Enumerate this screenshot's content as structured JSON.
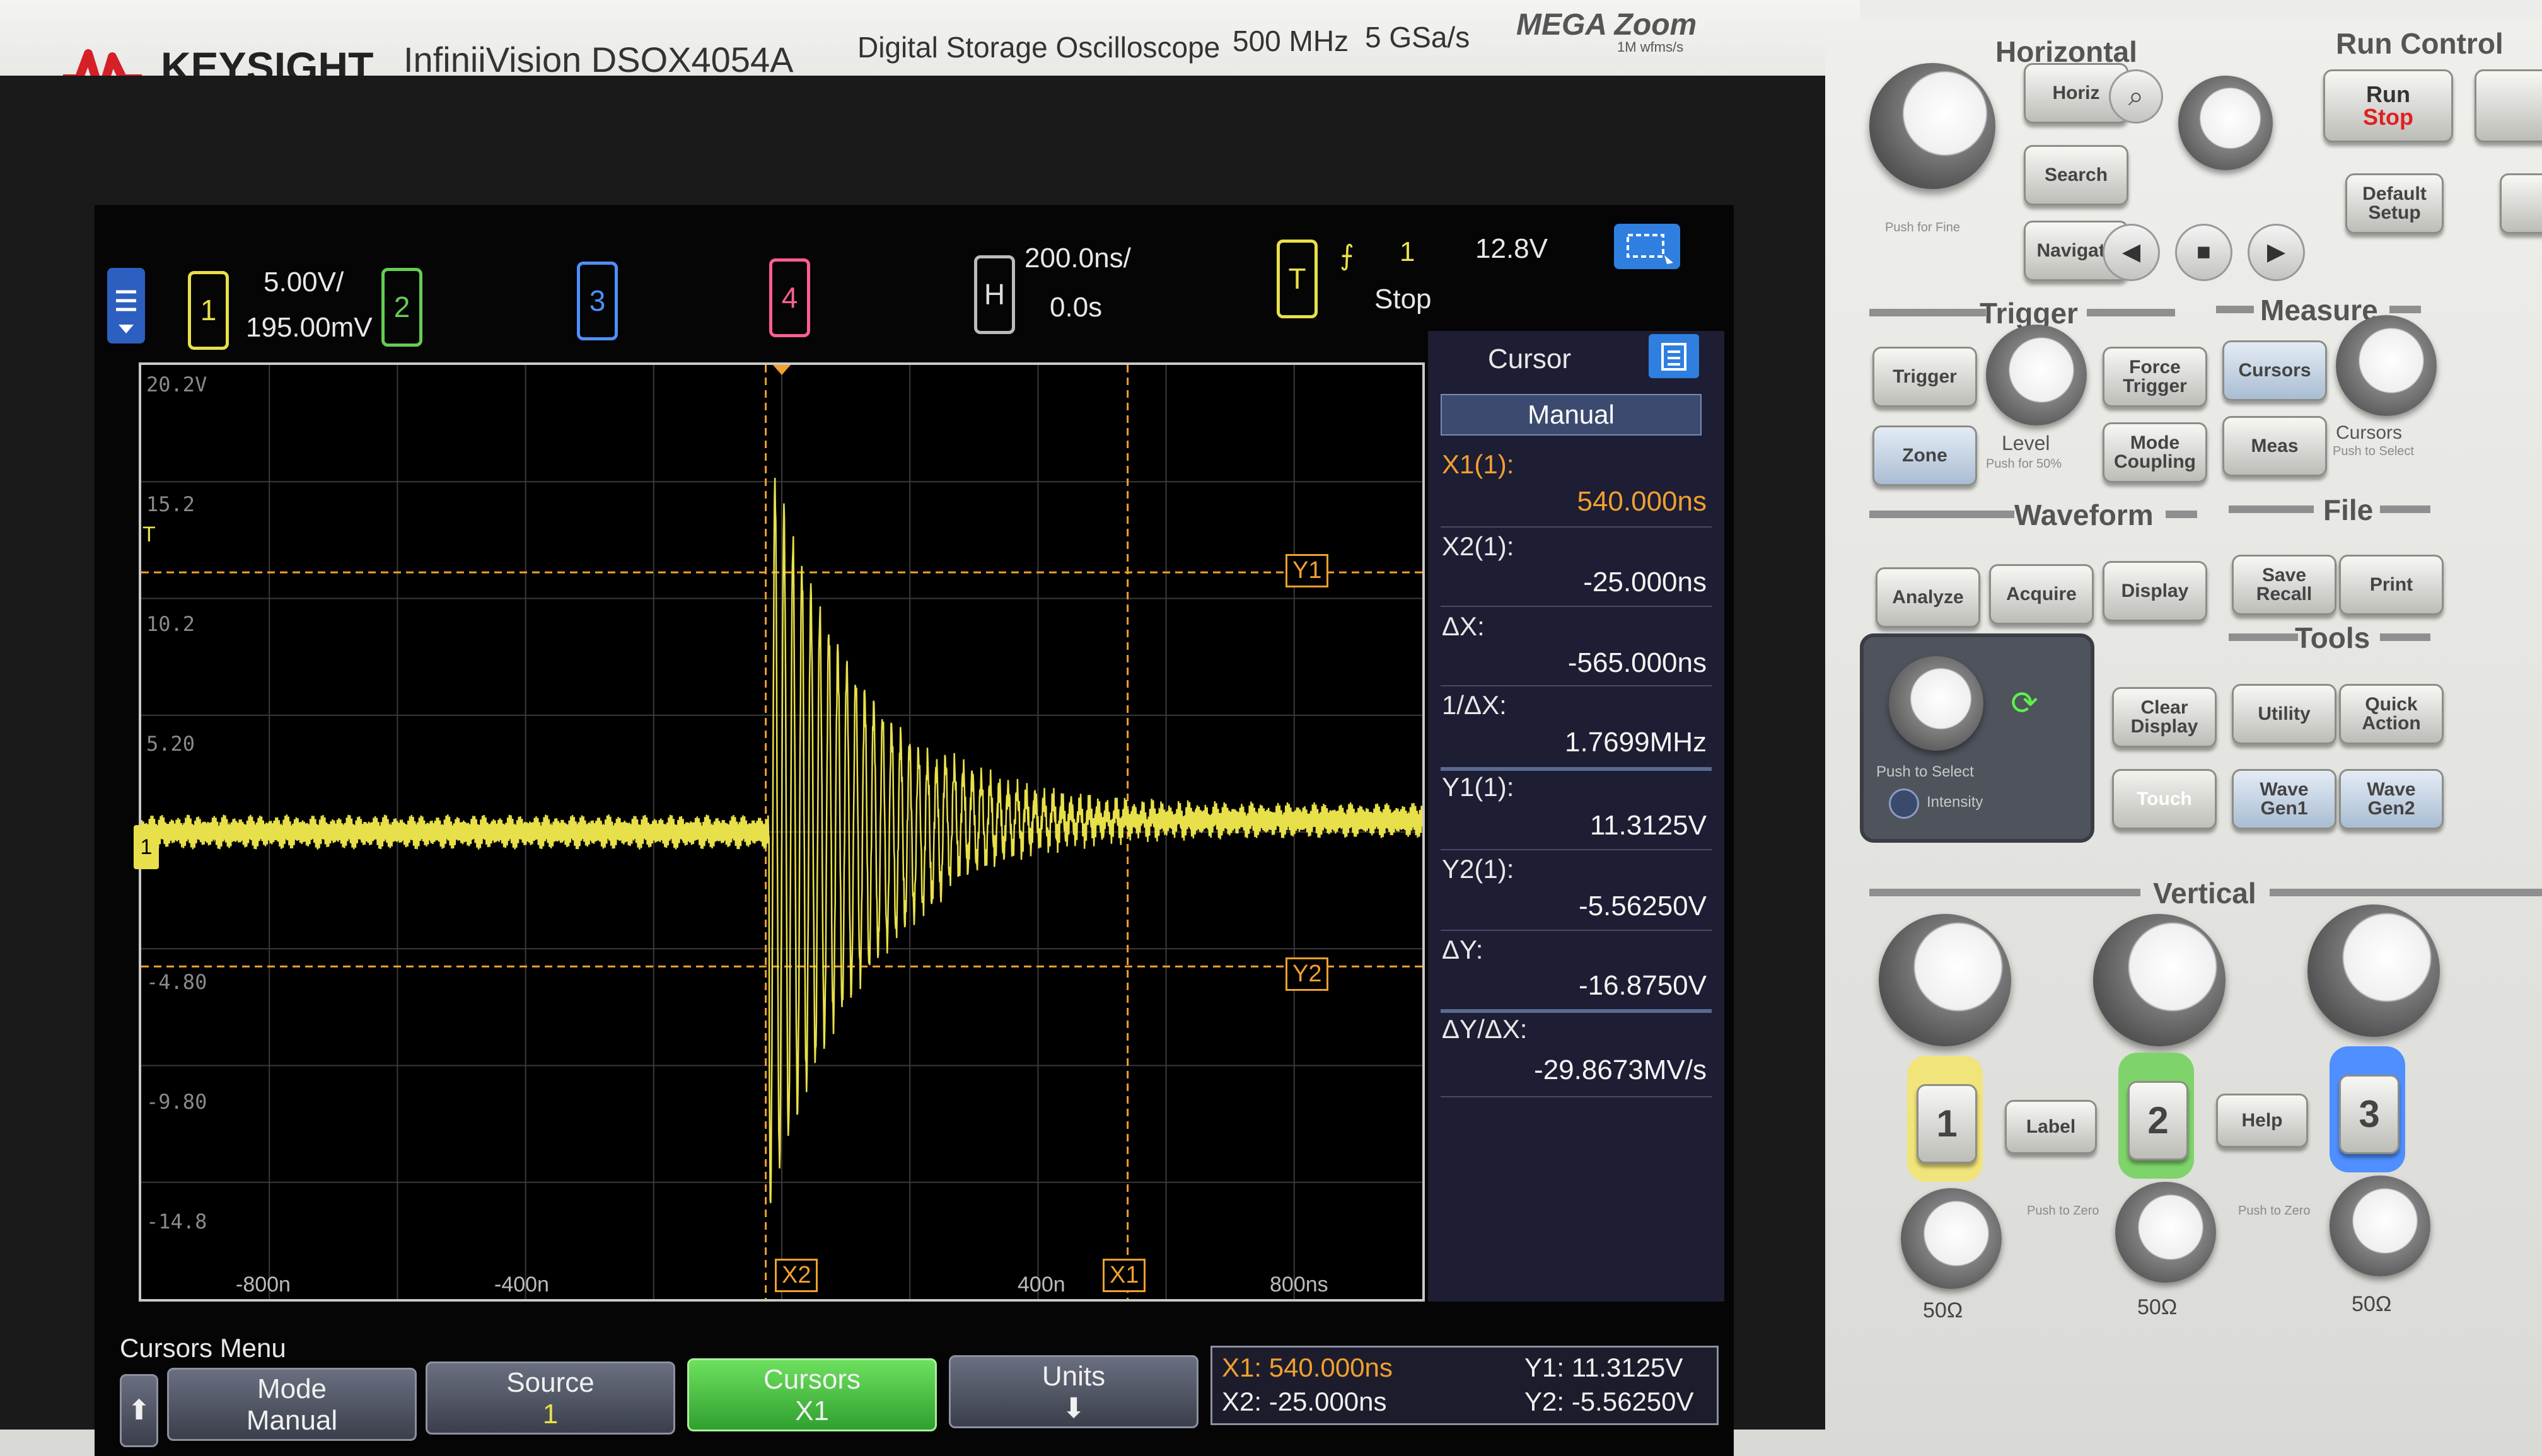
{
  "brand": {
    "logo": "KEYSIGHT",
    "model": "InfiniiVision DSOX4054A",
    "type": "Digital Storage Oscilloscope",
    "bandwidth": "500 MHz",
    "sample_rate": "5 GSa/s",
    "megazoom": "MEGA Zoom",
    "megazoom_sub": "1M wfms/s"
  },
  "header": {
    "ch1_num": "1",
    "ch1_scale": "5.00V/",
    "ch1_offset": "195.00mV",
    "ch2_num": "2",
    "ch3_num": "3",
    "ch4_num": "4",
    "h_label": "H",
    "timebase": "200.0ns/",
    "delay": "0.0s",
    "t_label": "T",
    "trig_source": "1",
    "trig_level": "12.8V",
    "run_state": "Stop"
  },
  "plot": {
    "y_labels": [
      "20.2V",
      "15.2",
      "10.2",
      "5.20",
      "-4.80",
      "-9.80",
      "-14.8"
    ],
    "x_labels": [
      "-800n",
      "-400n",
      "400n",
      "800ns"
    ],
    "cursor_tags": {
      "y1": "Y1",
      "y2": "Y2",
      "x1": "X1",
      "x2": "X2"
    },
    "trig_marker": "T",
    "ch1_marker": "1"
  },
  "cursor_panel": {
    "title": "Cursor",
    "mode": "Manual",
    "rows": [
      {
        "label": "X1(1):",
        "value": "540.000ns"
      },
      {
        "label": "X2(1):",
        "value": "-25.000ns"
      },
      {
        "label": "ΔX:",
        "value": "-565.000ns"
      },
      {
        "label": "1/ΔX:",
        "value": "1.7699MHz"
      },
      {
        "label": "Y1(1):",
        "value": "11.3125V"
      },
      {
        "label": "Y2(1):",
        "value": "-5.56250V"
      },
      {
        "label": "ΔY:",
        "value": "-16.8750V"
      },
      {
        "label": "ΔY/ΔX:",
        "value": "-29.8673MV/s"
      }
    ]
  },
  "softkeys": {
    "menu_title": "Cursors Menu",
    "mode_label": "Mode",
    "mode_value": "Manual",
    "source_label": "Source",
    "source_value": "1",
    "cursors_label": "Cursors",
    "cursors_value": "X1",
    "units_label": "Units",
    "readout_x1": "X1:  540.000ns",
    "readout_x2": "X2:  -25.000ns",
    "readout_y1": "Y1: 11.3125V",
    "readout_y2": "Y2: -5.56250V"
  },
  "front_panel": {
    "horizontal": "Horizontal",
    "run_control": "Run Control",
    "horiz_btn": "Horiz",
    "search_btn": "Search",
    "navigate_btn": "Navigate",
    "run_stop_top": "Run",
    "run_stop_bottom": "Stop",
    "default_setup": "Default Setup",
    "push_fine": "Push for Fine",
    "trigger": "Trigger",
    "trigger_btn": "Trigger",
    "force_trigger": "Force Trigger",
    "zone_btn": "Zone",
    "level": "Level",
    "level_sub": "Push for 50%",
    "mode_coupling": "Mode Coupling",
    "measure": "Measure",
    "cursors_btn": "Cursors",
    "meas_btn": "Meas",
    "cursors_knob": "Cursors",
    "cursors_knob_sub": "Push to Select",
    "waveform": "Waveform",
    "analyze": "Analyze",
    "acquire": "Acquire",
    "display": "Display",
    "file": "File",
    "save_recall": "Save Recall",
    "print": "Print",
    "tools": "Tools",
    "utility": "Utility",
    "quick_action": "Quick Action",
    "clear_display": "Clear Display",
    "touch": "Touch",
    "wavegen1": "Wave Gen1",
    "wavegen2": "Wave Gen2",
    "push_select": "Push to Select",
    "intensity": "Intensity",
    "vertical": "Vertical",
    "label_btn": "Label",
    "help_btn": "Help",
    "ch1": "1",
    "ch2": "2",
    "ch3": "3",
    "push_zero": "Push to Zero",
    "ohm1": "50Ω",
    "ohm2": "50Ω",
    "ohm3": "50Ω"
  },
  "colors": {
    "ch1": "#e8e04a",
    "ch2": "#66cc55",
    "ch3": "#4f8fff",
    "ch4": "#ff5f8f",
    "cursor": "#f0a030",
    "panel_accent": "#2f7fe0"
  }
}
